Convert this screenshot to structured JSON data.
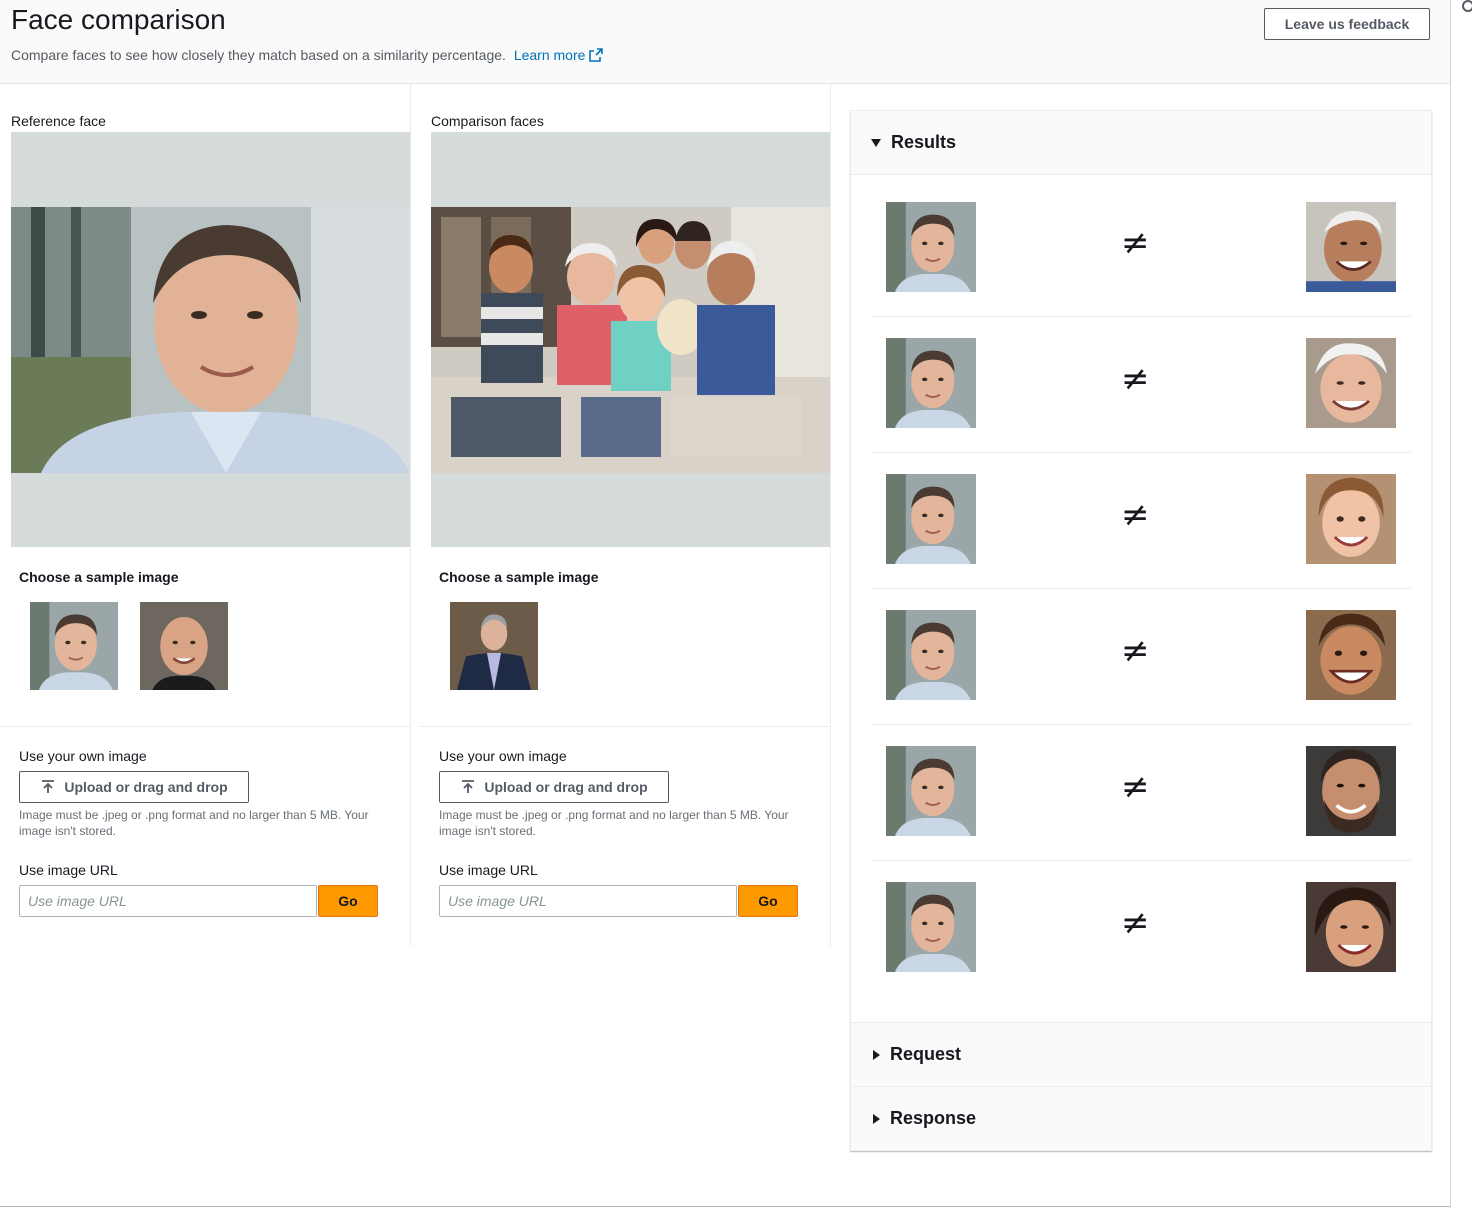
{
  "header": {
    "title": "Face comparison",
    "description": "Compare faces to see how closely they match based on a similarity percentage.",
    "learn_more": "Learn more",
    "feedback_button": "Leave us feedback"
  },
  "reference": {
    "label": "Reference face",
    "sample_label": "Choose a sample image",
    "own_image_label": "Use your own image",
    "upload_button": "Upload or drag and drop",
    "upload_hint": "Image must be .jpeg or .png format and no larger than 5 MB. Your image isn't stored.",
    "url_label": "Use image URL",
    "url_placeholder": "Use image URL",
    "go_button": "Go"
  },
  "comparison": {
    "label": "Comparison faces",
    "sample_label": "Choose a sample image",
    "own_image_label": "Use your own image",
    "upload_button": "Upload or drag and drop",
    "upload_hint": "Image must be .jpeg or .png format and no larger than 5 MB. Your image isn't stored.",
    "url_label": "Use image URL",
    "url_placeholder": "Use image URL",
    "go_button": "Go"
  },
  "results": {
    "title": "Results",
    "symbol": "≠",
    "rows": [
      {
        "match": false
      },
      {
        "match": false
      },
      {
        "match": false
      },
      {
        "match": false
      },
      {
        "match": false
      },
      {
        "match": false
      }
    ]
  },
  "request": {
    "title": "Request"
  },
  "response": {
    "title": "Response"
  },
  "colors": {
    "accent": "#ff9900",
    "link": "#0073bb",
    "placeholder_bg": "#d5dbdb"
  },
  "icons": {
    "external_link": "external-link-icon",
    "upload": "upload-icon",
    "caret_down": "caret-down-icon",
    "caret_right": "caret-right-icon",
    "not_equal": "not-equal-icon"
  }
}
